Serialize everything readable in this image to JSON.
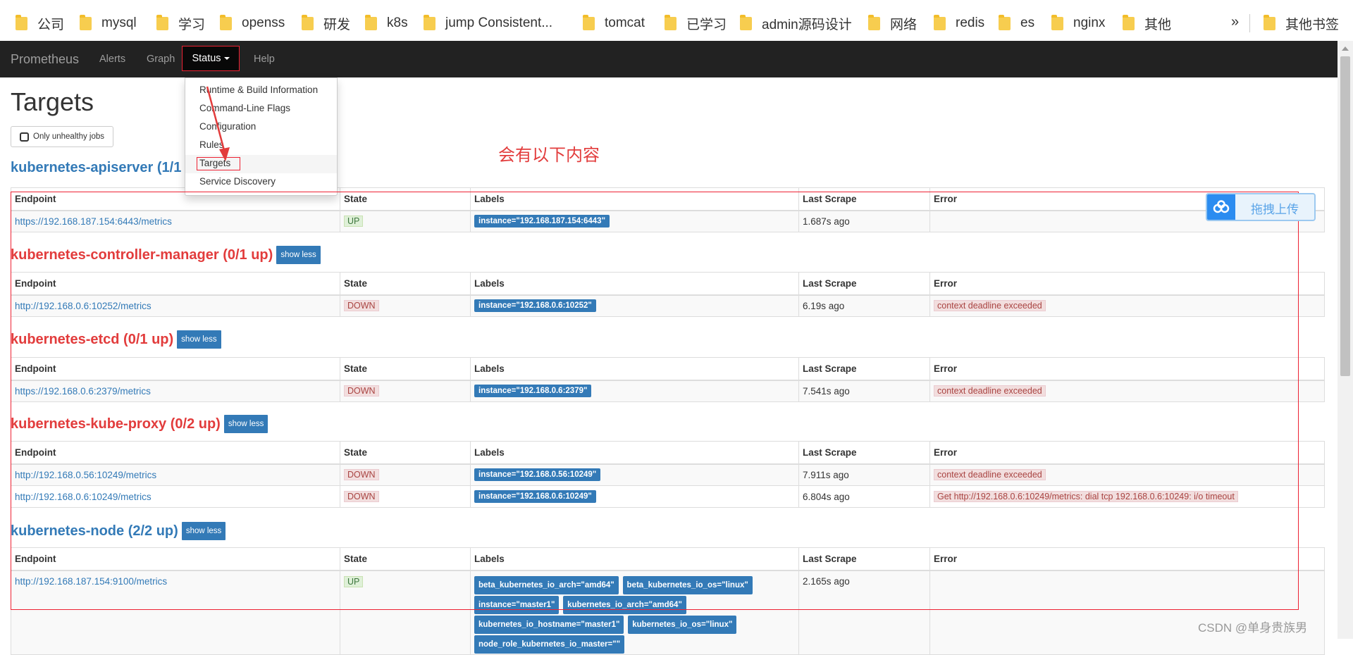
{
  "bookmarks": {
    "items": [
      "公司",
      "mysql",
      "学习",
      "openss",
      "研发",
      "k8s",
      "jump Consistent...",
      "tomcat",
      "已学习",
      "admin源码设计",
      "网络",
      "redis",
      "es",
      "nginx",
      "其他"
    ],
    "more": "»",
    "other": "其他书签"
  },
  "navbar": {
    "brand": "Prometheus",
    "alerts": "Alerts",
    "graph": "Graph",
    "status": "Status",
    "help": "Help"
  },
  "status_menu": {
    "items": [
      "Runtime & Build Information",
      "Command-Line Flags",
      "Configuration",
      "Rules",
      "Targets",
      "Service Discovery"
    ],
    "active": "Targets"
  },
  "page": {
    "title": "Targets",
    "unhealthy_button": "Only unhealthy jobs"
  },
  "columns": [
    "Endpoint",
    "State",
    "Labels",
    "Last Scrape",
    "Error"
  ],
  "show_less": "show less",
  "jobs": [
    {
      "title": "kubernetes-apiserver (1/1 up)",
      "rows": [
        {
          "endpoint": "https://192.168.187.154:6443/metrics",
          "state": "UP",
          "labels": [
            "instance=\"192.168.187.154:6443\""
          ],
          "last_scrape": "1.687s ago",
          "error": ""
        }
      ]
    },
    {
      "title": "kubernetes-controller-manager (0/1 up)",
      "rows": [
        {
          "endpoint": "http://192.168.0.6:10252/metrics",
          "state": "DOWN",
          "labels": [
            "instance=\"192.168.0.6:10252\""
          ],
          "last_scrape": "6.19s ago",
          "error": "context deadline exceeded"
        }
      ]
    },
    {
      "title": "kubernetes-etcd (0/1 up)",
      "rows": [
        {
          "endpoint": "https://192.168.0.6:2379/metrics",
          "state": "DOWN",
          "labels": [
            "instance=\"192.168.0.6:2379\""
          ],
          "last_scrape": "7.541s ago",
          "error": "context deadline exceeded"
        }
      ]
    },
    {
      "title": "kubernetes-kube-proxy (0/2 up)",
      "rows": [
        {
          "endpoint": "http://192.168.0.56:10249/metrics",
          "state": "DOWN",
          "labels": [
            "instance=\"192.168.0.56:10249\""
          ],
          "last_scrape": "7.911s ago",
          "error": "context deadline exceeded"
        },
        {
          "endpoint": "http://192.168.0.6:10249/metrics",
          "state": "DOWN",
          "labels": [
            "instance=\"192.168.0.6:10249\""
          ],
          "last_scrape": "6.804s ago",
          "error": "Get http://192.168.0.6:10249/metrics: dial tcp 192.168.0.6:10249: i/o timeout"
        }
      ]
    },
    {
      "title": "kubernetes-node (2/2 up)",
      "rows": [
        {
          "endpoint": "http://192.168.187.154:9100/metrics",
          "state": "UP",
          "labels": [
            "beta_kubernetes_io_arch=\"amd64\"",
            "beta_kubernetes_io_os=\"linux\"",
            "instance=\"master1\"",
            "kubernetes_io_arch=\"amd64\"",
            "kubernetes_io_hostname=\"master1\"",
            "kubernetes_io_os=\"linux\"",
            "node_role_kubernetes_io_master=\"\""
          ],
          "last_scrape": "2.165s ago",
          "error": ""
        }
      ]
    }
  ],
  "annotation": {
    "text": "会有以下内容"
  },
  "upload": {
    "label": "拖拽上传"
  },
  "watermark": "CSDN @单身贵族男",
  "colors": {
    "navbar": "#222222",
    "link": "#337ab7",
    "annotation_red": "#e23c3c",
    "up_green": "#3c763d",
    "down_red": "#a94442"
  }
}
